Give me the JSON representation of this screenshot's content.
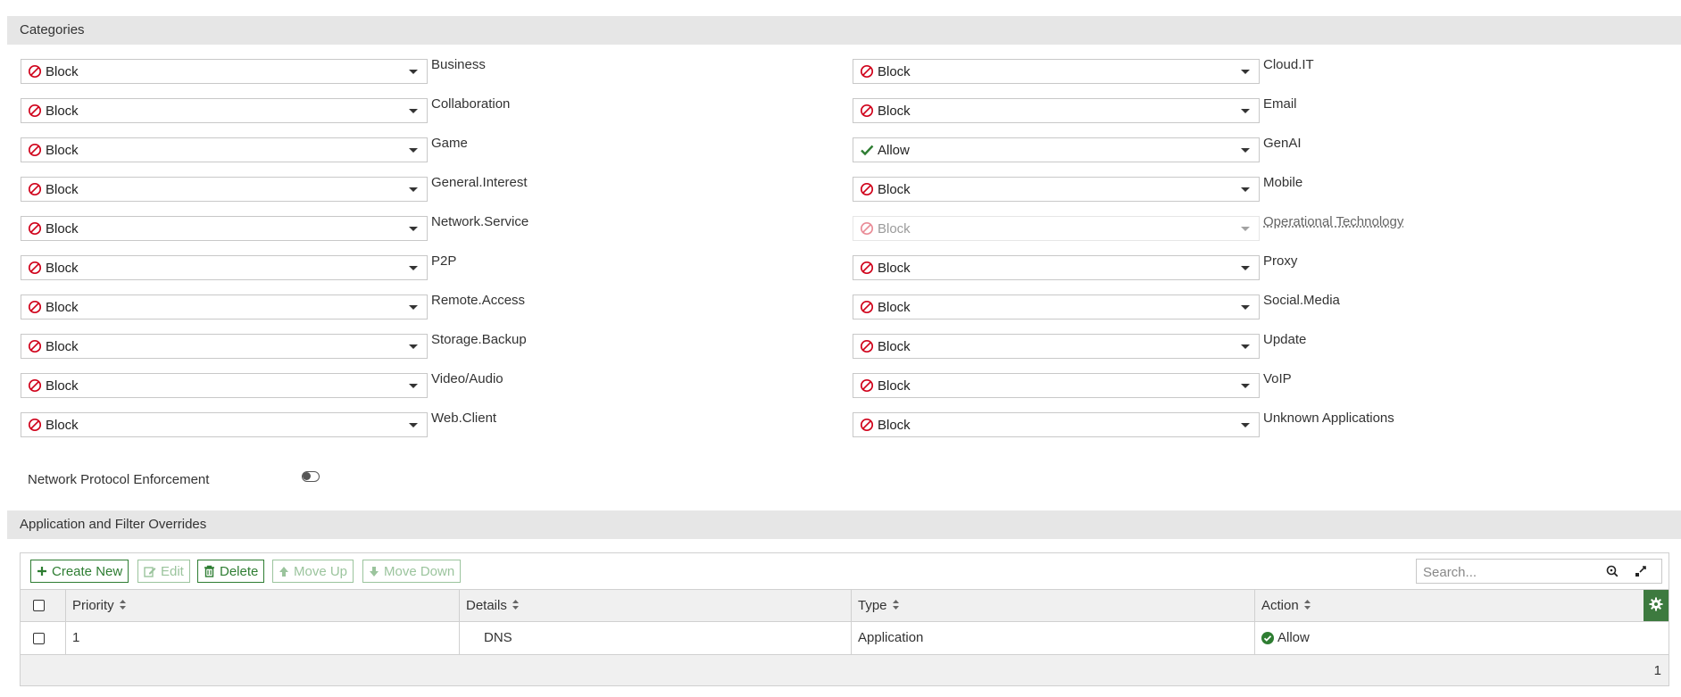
{
  "sections": {
    "categories_title": "Categories",
    "overrides_title": "Application and Filter Overrides"
  },
  "categories": [
    {
      "action": "Block",
      "label": "Business",
      "icon": "block-icon"
    },
    {
      "action": "Block",
      "label": "Cloud.IT",
      "icon": "block-icon"
    },
    {
      "action": "Block",
      "label": "Collaboration",
      "icon": "block-icon"
    },
    {
      "action": "Block",
      "label": "Email",
      "icon": "block-icon"
    },
    {
      "action": "Block",
      "label": "Game",
      "icon": "block-icon"
    },
    {
      "action": "Allow",
      "label": "GenAI",
      "icon": "checkmark-icon"
    },
    {
      "action": "Block",
      "label": "General.Interest",
      "icon": "block-icon"
    },
    {
      "action": "Block",
      "label": "Mobile",
      "icon": "block-icon"
    },
    {
      "action": "Block",
      "label": "Network.Service",
      "icon": "block-icon"
    },
    {
      "action": "Block",
      "label": "Operational Technology",
      "icon": "block-icon",
      "disabled": true
    },
    {
      "action": "Block",
      "label": "P2P",
      "icon": "block-icon"
    },
    {
      "action": "Block",
      "label": "Proxy",
      "icon": "block-icon"
    },
    {
      "action": "Block",
      "label": "Remote.Access",
      "icon": "block-icon"
    },
    {
      "action": "Block",
      "label": "Social.Media",
      "icon": "block-icon"
    },
    {
      "action": "Block",
      "label": "Storage.Backup",
      "icon": "block-icon"
    },
    {
      "action": "Block",
      "label": "Update",
      "icon": "block-icon"
    },
    {
      "action": "Block",
      "label": "Video/Audio",
      "icon": "block-icon"
    },
    {
      "action": "Block",
      "label": "VoIP",
      "icon": "block-icon"
    },
    {
      "action": "Block",
      "label": "Web.Client",
      "icon": "block-icon"
    },
    {
      "action": "Block",
      "label": "Unknown Applications",
      "icon": "block-icon"
    }
  ],
  "network_protocol_enforcement": {
    "label": "Network Protocol Enforcement",
    "enabled": false
  },
  "toolbar": {
    "create_new": "Create New",
    "edit": "Edit",
    "delete": "Delete",
    "move_up": "Move Up",
    "move_down": "Move Down"
  },
  "search": {
    "placeholder": "Search..."
  },
  "table": {
    "columns": [
      "Priority",
      "Details",
      "Type",
      "Action"
    ],
    "rows": [
      {
        "priority": "1",
        "details": "DNS",
        "type": "Application",
        "action": "Allow"
      }
    ],
    "footer_count": "1"
  },
  "colors": {
    "block": "#d0021b",
    "allow": "#2e7d32",
    "accent_green": "#3d7a3f",
    "header_gray": "#e6e6e6"
  }
}
